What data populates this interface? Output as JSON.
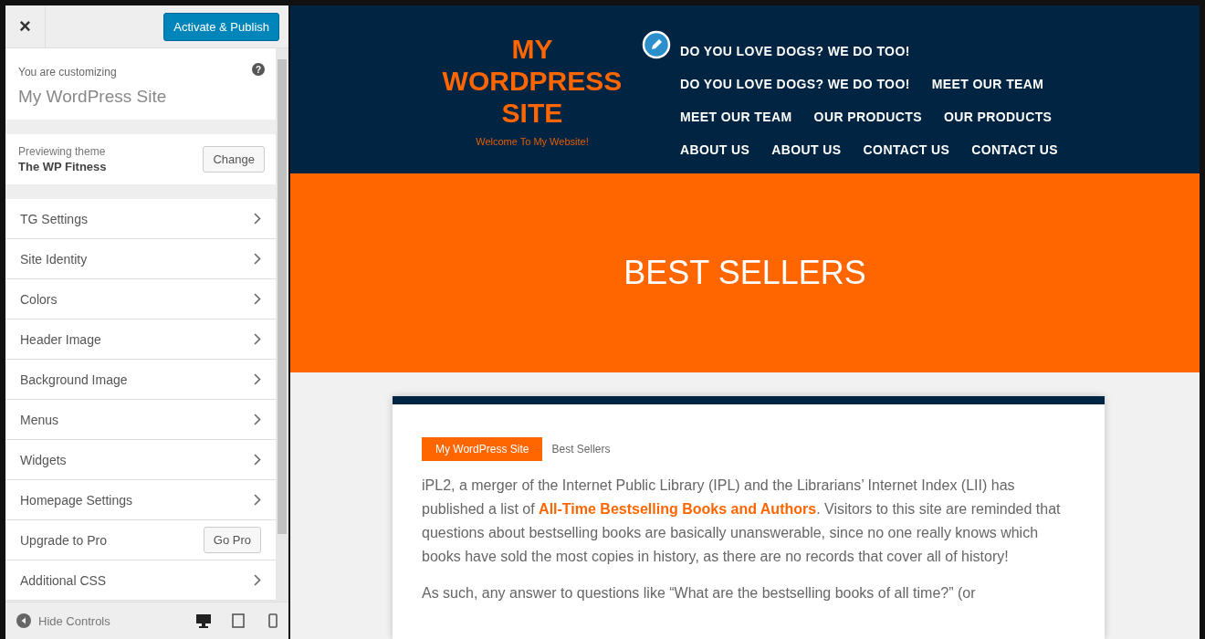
{
  "sidebar": {
    "close": "×",
    "publish_button": "Activate & Publish",
    "customizing_label": "You are customizing",
    "site_name": "My WordPress Site",
    "help": "?",
    "theme_label": "Previewing theme",
    "theme_name": "The WP Fitness",
    "change_button": "Change",
    "items": [
      {
        "kind": "section",
        "label": "TG Settings"
      },
      {
        "kind": "section",
        "label": "Site Identity"
      },
      {
        "kind": "section",
        "label": "Colors"
      },
      {
        "kind": "section",
        "label": "Header Image"
      },
      {
        "kind": "section",
        "label": "Background Image"
      },
      {
        "kind": "section",
        "label": "Menus"
      },
      {
        "kind": "section",
        "label": "Widgets"
      },
      {
        "kind": "section",
        "label": "Homepage Settings"
      },
      {
        "kind": "action",
        "label": "Upgrade to Pro",
        "button": "Go Pro"
      },
      {
        "kind": "section",
        "label": "Additional CSS"
      }
    ],
    "hide_controls": "Hide Controls"
  },
  "preview": {
    "site_title": "MY WORDPRESS SITE",
    "tagline": "Welcome To My Website!",
    "nav_rows": [
      [
        "DO YOU LOVE DOGS? WE DO TOO!"
      ],
      [
        "DO YOU LOVE DOGS? WE DO TOO!",
        "MEET OUR TEAM"
      ],
      [
        "MEET OUR TEAM",
        "OUR PRODUCTS",
        "OUR PRODUCTS"
      ],
      [
        "ABOUT US",
        "ABOUT US",
        "CONTACT US",
        "CONTACT US"
      ]
    ],
    "banner_title": "BEST SELLERS",
    "breadcrumb": [
      "My WordPress Site",
      "Best Sellers"
    ],
    "paragraph_1": {
      "before": "iPL2, a merger of the Internet Public Library (IPL) and the Librarians’ Internet Index (LII) has published a list of ",
      "link": "All-Time Bestselling Books and Authors",
      "after": ". Visitors to this site are reminded that questions about bestselling books are basically unanswerable, since no one really knows which books have sold the most copies in history, as there are no records that cover all of history!"
    },
    "paragraph_2": "As such, any answer to questions like “What are the bestselling books of all time?” (or"
  }
}
